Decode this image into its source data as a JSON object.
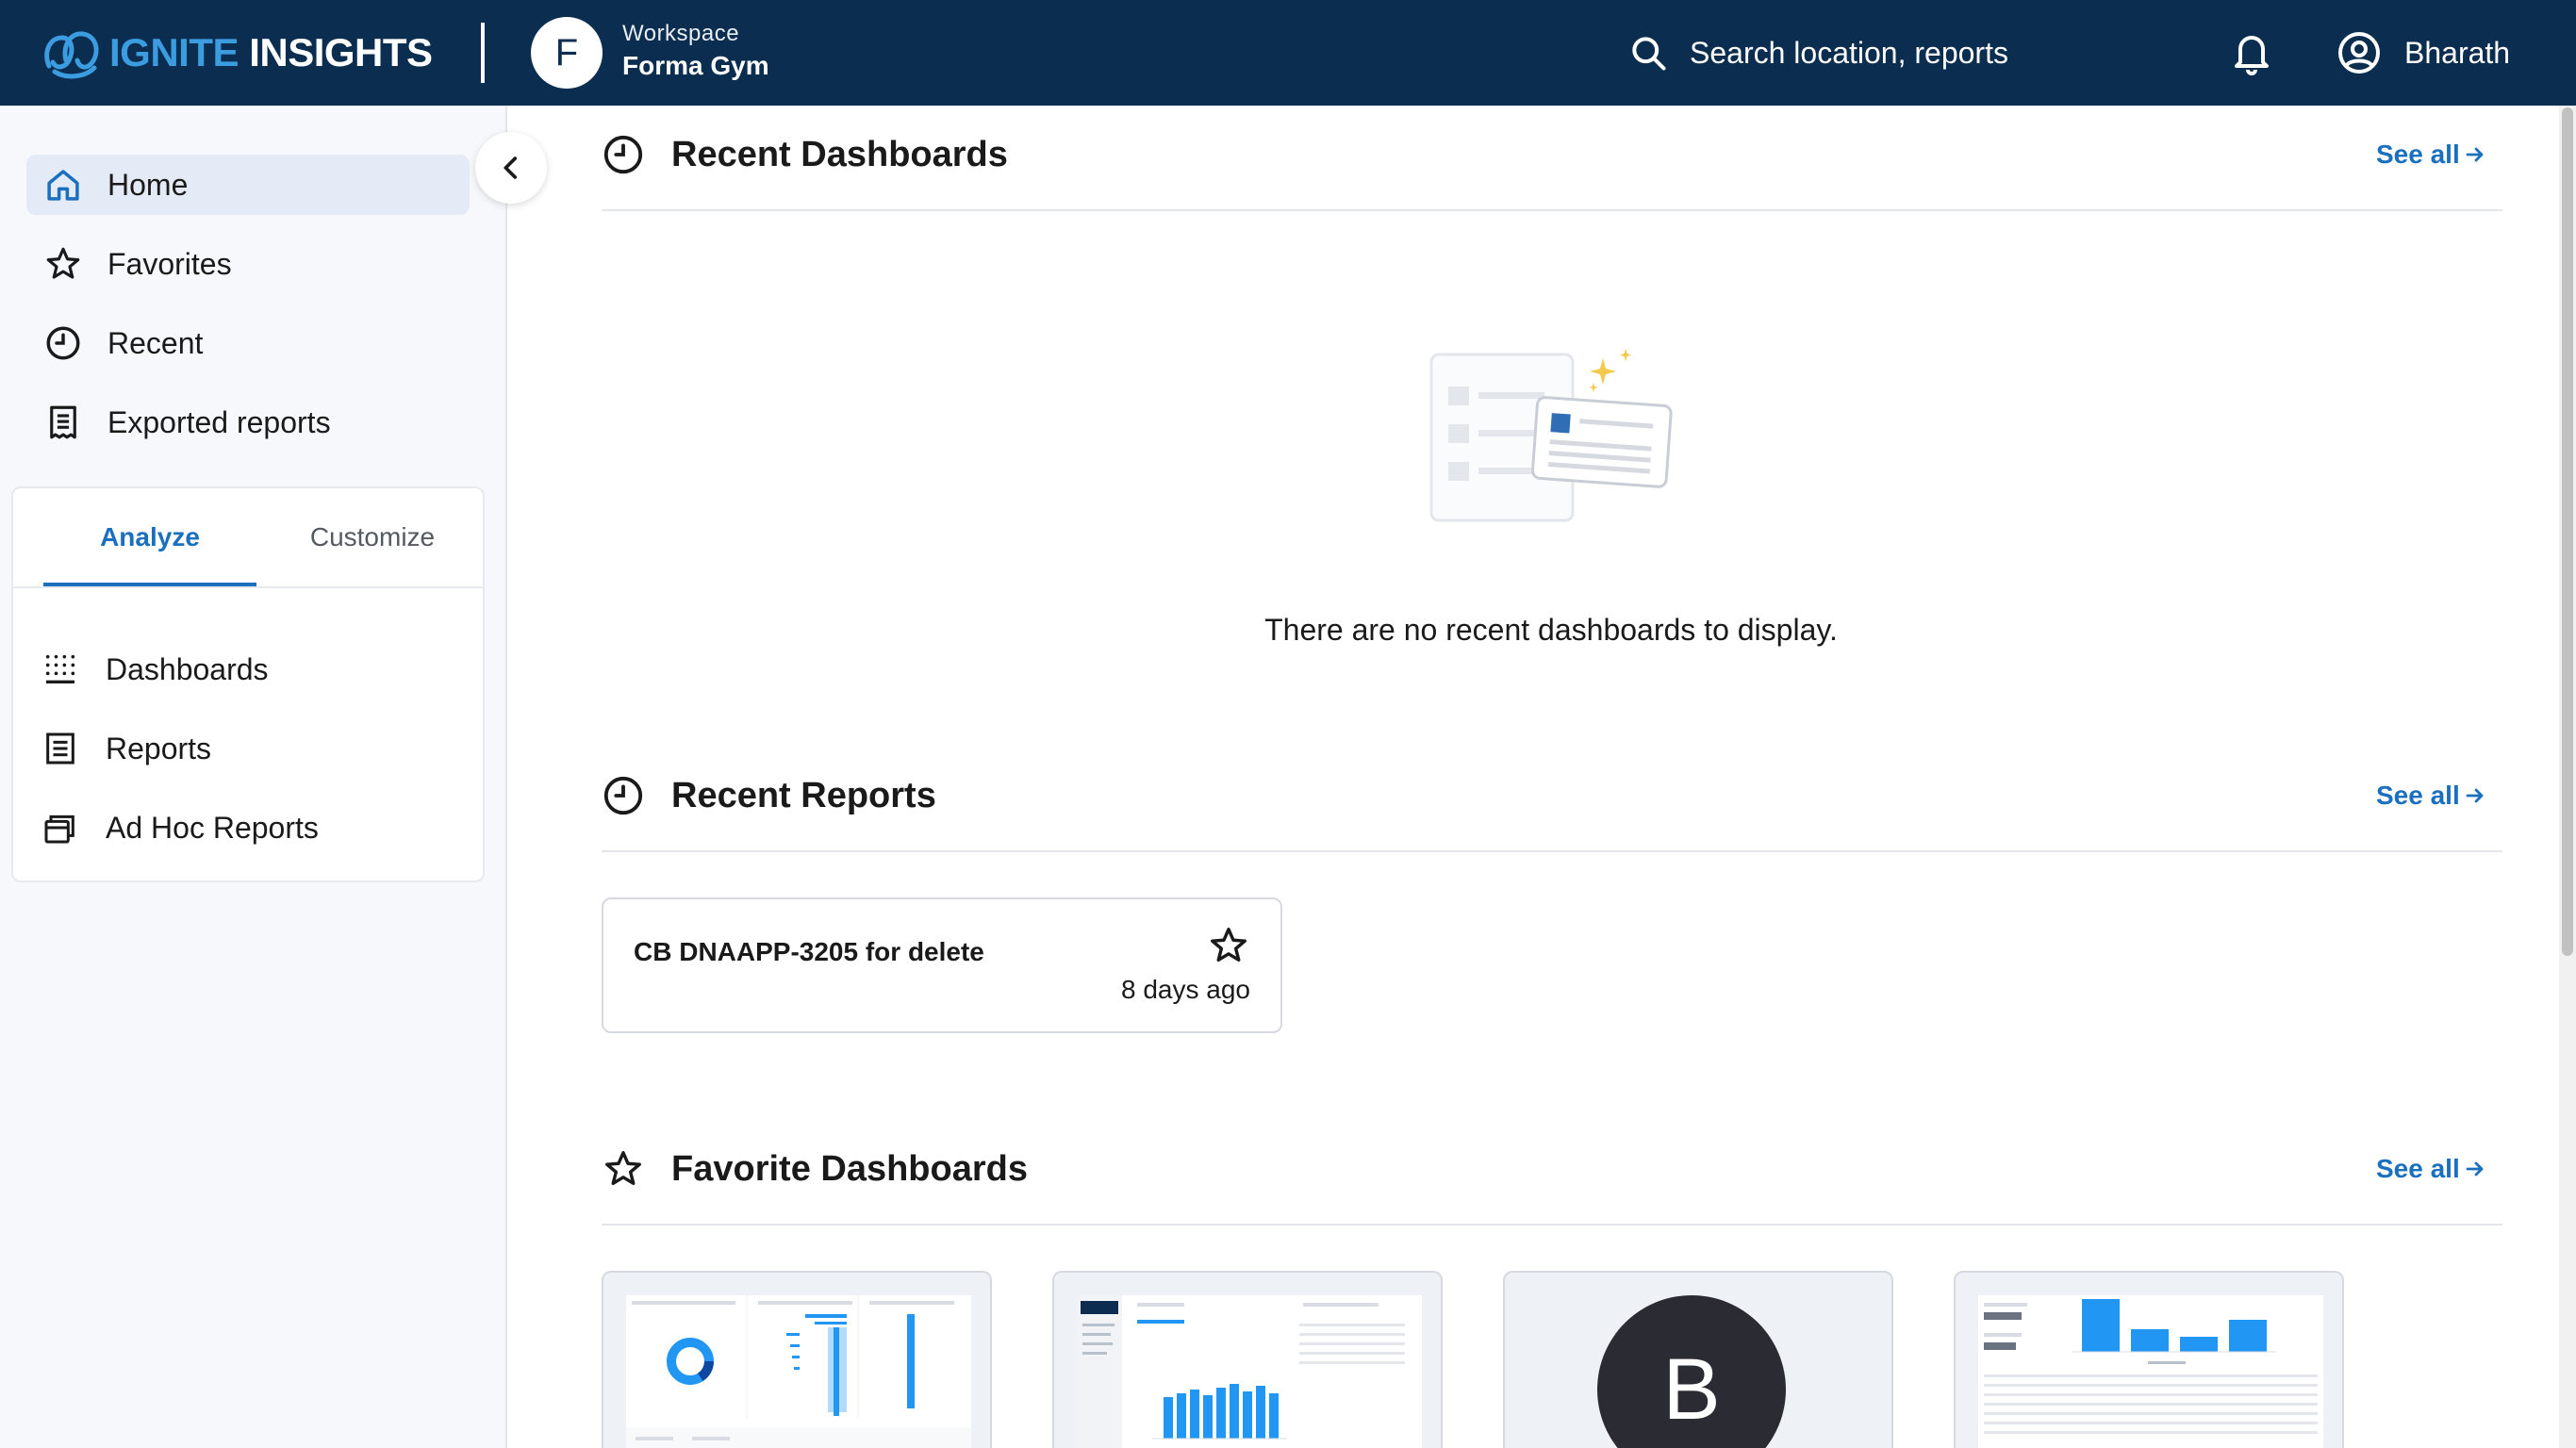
{
  "header": {
    "logo_part1": "IGNITE",
    "logo_part2": "INSIGHTS",
    "workspace_initial": "F",
    "workspace_label": "Workspace",
    "workspace_name": "Forma Gym",
    "search_placeholder": "Search location, reports",
    "user_name": "Bharath"
  },
  "sidebar": {
    "nav": [
      {
        "label": "Home",
        "icon": "home-icon",
        "active": true
      },
      {
        "label": "Favorites",
        "icon": "star-icon"
      },
      {
        "label": "Recent",
        "icon": "clock-icon"
      },
      {
        "label": "Exported reports",
        "icon": "receipt-icon"
      }
    ],
    "tabs": [
      {
        "label": "Analyze",
        "active": true
      },
      {
        "label": "Customize"
      }
    ],
    "analyze_items": [
      {
        "label": "Dashboards",
        "icon": "dotted-grid-icon"
      },
      {
        "label": "Reports",
        "icon": "report-icon"
      },
      {
        "label": "Ad Hoc Reports",
        "icon": "stacked-cards-icon"
      }
    ]
  },
  "main": {
    "recent_dashboards": {
      "title": "Recent Dashboards",
      "see_all": "See all",
      "empty_message": "There are no recent dashboards to display."
    },
    "recent_reports": {
      "title": "Recent Reports",
      "see_all": "See all",
      "items": [
        {
          "title": "CB DNAAPP-3205 for delete",
          "time": "8 days ago"
        }
      ]
    },
    "favorite_dashboards": {
      "title": "Favorite Dashboards",
      "see_all": "See all",
      "thumb_avatar_letter": "B"
    }
  },
  "colors": {
    "header_bg": "#0b2d4f",
    "accent": "#1b6fbf",
    "sidebar_bg": "#f6f8fb",
    "active_nav_bg": "#e4ebf6",
    "chart_blue": "#2196f3"
  }
}
